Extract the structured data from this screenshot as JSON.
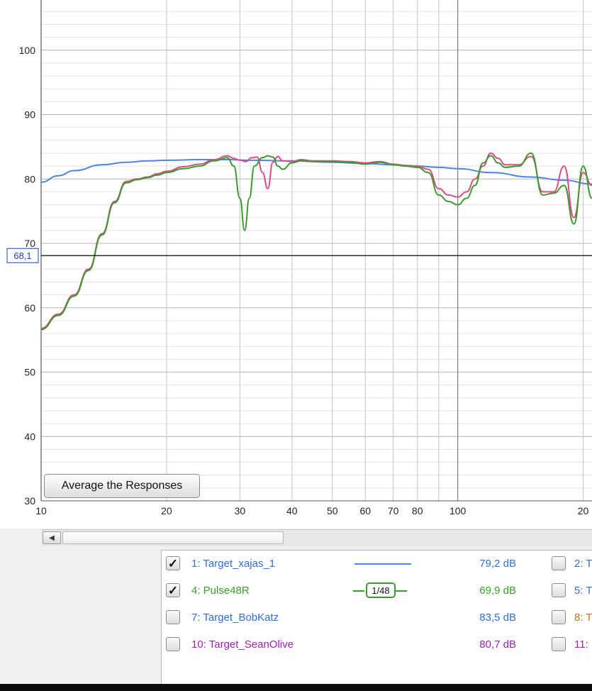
{
  "colors": {
    "target_xajas": "#4a86e8",
    "pulse48r": "#3a9d2a",
    "pulse_overlay": "#e0498a",
    "bobkatz": "#2f6fd6",
    "seanolive": "#9c1fb0",
    "slot2": "#2f6fd6",
    "slot5": "#2f6fd6",
    "slot8": "#c07418",
    "slot11": "#9c1fb0"
  },
  "chart_data": {
    "type": "line",
    "x_scale": "log",
    "xlim": [
      10,
      210
    ],
    "ylim": [
      30,
      110
    ],
    "x_ticks": [
      {
        "value": 10,
        "label": "10"
      },
      {
        "value": 20,
        "label": "20"
      },
      {
        "value": 30,
        "label": "30"
      },
      {
        "value": 40,
        "label": "40"
      },
      {
        "value": 50,
        "label": "50"
      },
      {
        "value": 60,
        "label": "60"
      },
      {
        "value": 70,
        "label": "70"
      },
      {
        "value": 80,
        "label": "80"
      },
      {
        "value": 100,
        "label": "100"
      },
      {
        "value": 200,
        "label": "20"
      }
    ],
    "y_ticks": [
      {
        "value": 30,
        "label": "30"
      },
      {
        "value": 40,
        "label": "40"
      },
      {
        "value": 50,
        "label": "50"
      },
      {
        "value": 60,
        "label": "60"
      },
      {
        "value": 70,
        "label": "70"
      },
      {
        "value": 80,
        "label": "80"
      },
      {
        "value": 90,
        "label": "90"
      },
      {
        "value": 100,
        "label": "100"
      }
    ],
    "cursor": {
      "value": 68.1,
      "label": "68,1"
    },
    "grid": true,
    "series": [
      {
        "name": "1: Target_xajas_1",
        "color_key": "target_xajas",
        "x": [
          10,
          11,
          12,
          14,
          16,
          18,
          20,
          24,
          28,
          32,
          40,
          50,
          60,
          70,
          80,
          90,
          100,
          120,
          150,
          180,
          210
        ],
        "y": [
          79.5,
          80.5,
          81.3,
          82.2,
          82.6,
          82.8,
          82.9,
          83.0,
          83.0,
          82.9,
          82.8,
          82.6,
          82.4,
          82.2,
          82.0,
          81.8,
          81.6,
          81.0,
          80.3,
          79.8,
          79.2
        ]
      },
      {
        "name": "",
        "color_key": "pulse_overlay",
        "x": [
          10,
          11,
          12,
          13,
          14,
          15,
          16,
          17,
          18,
          19,
          20,
          22,
          24,
          26,
          28,
          29,
          30,
          31,
          32,
          33,
          34,
          35,
          36,
          37,
          38,
          40,
          42,
          45,
          50,
          55,
          60,
          65,
          70,
          75,
          80,
          85,
          90,
          95,
          100,
          105,
          110,
          115,
          120,
          125,
          130,
          140,
          150,
          160,
          170,
          180,
          190,
          200,
          210
        ],
        "y": [
          56.8,
          59.0,
          62.0,
          66.0,
          71.5,
          76.5,
          79.6,
          80.0,
          80.3,
          80.8,
          81.2,
          81.9,
          82.3,
          83.0,
          83.6,
          83.2,
          82.9,
          82.7,
          83.3,
          83.4,
          81.0,
          78.5,
          82.6,
          83.5,
          82.8,
          82.7,
          83.0,
          82.8,
          82.8,
          82.7,
          82.5,
          82.7,
          82.3,
          82.1,
          82.0,
          81.5,
          78.5,
          77.5,
          77.2,
          78.0,
          80.0,
          82.0,
          84.0,
          83.2,
          82.2,
          82.2,
          83.5,
          78.0,
          78.0,
          82.0,
          74.0,
          81.0,
          79.0
        ]
      },
      {
        "name": "4: Pulse48R",
        "color_key": "pulse48r",
        "x": [
          10,
          11,
          12,
          13,
          14,
          15,
          16,
          17,
          18,
          19,
          20,
          22,
          24,
          26,
          28,
          29,
          30,
          30.8,
          31.6,
          32.5,
          34,
          35,
          36,
          37,
          38,
          40,
          42,
          45,
          50,
          55,
          60,
          65,
          70,
          75,
          80,
          85,
          90,
          95,
          100,
          105,
          110,
          115,
          120,
          125,
          130,
          140,
          150,
          160,
          170,
          180,
          190,
          200,
          210
        ],
        "y": [
          56.6,
          58.8,
          61.8,
          65.8,
          71.3,
          76.3,
          79.4,
          79.9,
          80.2,
          80.6,
          81.0,
          81.6,
          82.0,
          82.8,
          83.3,
          82.0,
          77.0,
          72.0,
          77.0,
          82.0,
          83.3,
          83.6,
          83.4,
          82.0,
          81.5,
          82.5,
          82.8,
          82.7,
          82.7,
          82.6,
          82.3,
          82.6,
          82.2,
          82.0,
          81.8,
          81.0,
          77.5,
          76.5,
          76.0,
          77.0,
          79.0,
          82.5,
          83.6,
          82.5,
          81.8,
          82.0,
          84.0,
          77.5,
          77.8,
          79.0,
          73.0,
          82.0,
          77.0
        ]
      }
    ]
  },
  "controls": {
    "average_button": "Average the Responses",
    "scroll_left": "◀"
  },
  "legend": {
    "rows": [
      {
        "checked": true,
        "check_mark": "✓",
        "name": "1: Target_xajas_1",
        "value": "79,2 dB",
        "color": "#2f6fd6",
        "sample": "line",
        "right_label": "2: T",
        "right_color": "#2f6fd6"
      },
      {
        "checked": true,
        "check_mark": "✓",
        "name": "4: Pulse48R",
        "value": "69,9 dB",
        "color": "#3a9d2a",
        "sample": "badge",
        "smoothing": "1/48",
        "right_label": "5: T",
        "right_color": "#2f6fd6"
      },
      {
        "checked": false,
        "check_mark": "",
        "name": "7: Target_BobKatz",
        "value": "83,5 dB",
        "color": "#2f6fd6",
        "sample": "none",
        "right_label": "8: T",
        "right_color": "#c07418"
      },
      {
        "checked": false,
        "check_mark": "",
        "name": "10: Target_SeanOlive",
        "value": "80,7 dB",
        "color": "#9c1fb0",
        "sample": "none",
        "right_label": "11:",
        "right_color": "#9c1fb0"
      }
    ]
  }
}
